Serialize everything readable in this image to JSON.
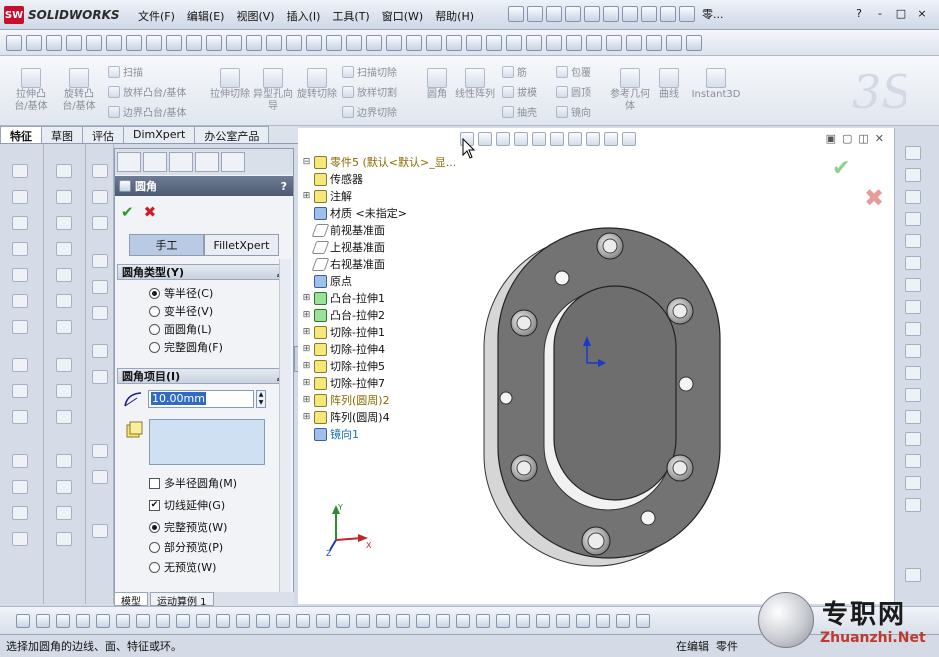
{
  "app": {
    "brand": "SOLIDWORKS",
    "logo_mark": "SW"
  },
  "menu": [
    "文件(F)",
    "编辑(E)",
    "视图(V)",
    "插入(I)",
    "工具(T)",
    "窗口(W)",
    "帮助(H)"
  ],
  "title_right": "零...",
  "window_controls": [
    "?",
    "-",
    "□",
    "×"
  ],
  "command_manager": {
    "large": [
      "拉伸凸台/基体",
      "旋转凸台/基体",
      "拉伸切除",
      "异型孔向导",
      "旋转切除",
      "圆角",
      "线性阵列",
      "参考几何体",
      "曲线",
      "Instant3D"
    ],
    "small": [
      "扫描",
      "放样凸台/基体",
      "边界凸台/基体",
      "扫描切除",
      "放样切割",
      "边界切除",
      "筋",
      "拔模",
      "抽壳",
      "包覆",
      "圆顶",
      "镜向"
    ]
  },
  "tabs": [
    "特征",
    "草图",
    "评估",
    "DimXpert",
    "办公室产品"
  ],
  "property_manager": {
    "title": "圆角",
    "help": "?",
    "ok_symbol": "✔",
    "cancel_symbol": "✖",
    "modes": [
      "手工",
      "FilletXpert"
    ],
    "fillet_type": {
      "header": "圆角类型(Y)",
      "options": [
        "等半径(C)",
        "变半径(V)",
        "面圆角(L)",
        "完整圆角(F)"
      ],
      "selected": "等半径(C)"
    },
    "fillet_items": {
      "header": "圆角项目(I)",
      "radius": "10.00mm",
      "multi_radius_label": "多半径圆角(M)",
      "multi_radius_checked": false,
      "tangent_propagation_label": "切线延伸(G)",
      "tangent_propagation_checked": true,
      "preview_options": [
        "完整预览(W)",
        "部分预览(P)",
        "无预览(W)"
      ],
      "preview_selected": "完整预览(W)"
    }
  },
  "bottom_tabs": [
    "模型",
    "运动算例 1"
  ],
  "feature_tree": [
    {
      "label": "零件5  (默认<默认>_显...",
      "icon": "part-icon",
      "expander": "⊟",
      "style": "yellow"
    },
    {
      "label": "传感器",
      "icon": "sensor-icon",
      "expander": "",
      "style": "normal"
    },
    {
      "label": "注解",
      "icon": "annotation-icon",
      "expander": "⊞",
      "style": "normal"
    },
    {
      "label": "材质 <未指定>",
      "icon": "material-icon",
      "expander": "",
      "style": "normal"
    },
    {
      "label": "前视基准面",
      "icon": "plane-icon",
      "expander": "",
      "style": "normal"
    },
    {
      "label": "上视基准面",
      "icon": "plane-icon",
      "expander": "",
      "style": "normal"
    },
    {
      "label": "右视基准面",
      "icon": "plane-icon",
      "expander": "",
      "style": "normal"
    },
    {
      "label": "原点",
      "icon": "origin-icon",
      "expander": "",
      "style": "normal"
    },
    {
      "label": "凸台-拉伸1",
      "icon": "extrude-icon",
      "expander": "⊞",
      "style": "normal"
    },
    {
      "label": "凸台-拉伸2",
      "icon": "extrude-icon",
      "expander": "⊞",
      "style": "normal"
    },
    {
      "label": "切除-拉伸1",
      "icon": "cut-icon",
      "expander": "⊞",
      "style": "normal"
    },
    {
      "label": "切除-拉伸4",
      "icon": "cut-icon",
      "expander": "⊞",
      "style": "normal"
    },
    {
      "label": "切除-拉伸5",
      "icon": "cut-icon",
      "expander": "⊞",
      "style": "normal"
    },
    {
      "label": "切除-拉伸7",
      "icon": "cut-icon",
      "expander": "⊞",
      "style": "normal"
    },
    {
      "label": "阵列(圆周)2",
      "icon": "pattern-icon",
      "expander": "⊞",
      "style": "yellow"
    },
    {
      "label": "阵列(圆周)4",
      "icon": "pattern-icon",
      "expander": "⊞",
      "style": "normal"
    },
    {
      "label": "镜向1",
      "icon": "mirror-icon",
      "expander": "",
      "style": "cyan"
    }
  ],
  "confirm": {
    "ok": "✔",
    "cancel": "✖"
  },
  "viewport_window_controls": [
    "▣",
    "▢",
    "◫",
    "✕"
  ],
  "status": {
    "message": "选择加圆角的边线、面、特征或环。",
    "mode": "在编辑",
    "context": "零件"
  },
  "watermark": {
    "cn": "专职网",
    "en": "Zhuanzhi.Net"
  },
  "colors": {
    "accent": "#316ac5",
    "part_face": "#737373",
    "ok": "#2a9a2a",
    "cancel": "#c8202a",
    "brand_red": "#c8102e"
  }
}
